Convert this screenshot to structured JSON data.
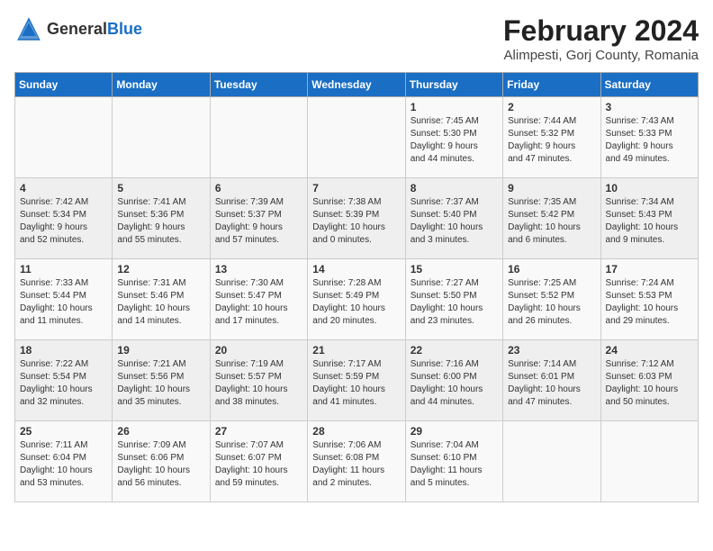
{
  "header": {
    "logo_general": "General",
    "logo_blue": "Blue",
    "month_year": "February 2024",
    "location": "Alimpesti, Gorj County, Romania"
  },
  "days_of_week": [
    "Sunday",
    "Monday",
    "Tuesday",
    "Wednesday",
    "Thursday",
    "Friday",
    "Saturday"
  ],
  "weeks": [
    [
      {
        "day": "",
        "info": ""
      },
      {
        "day": "",
        "info": ""
      },
      {
        "day": "",
        "info": ""
      },
      {
        "day": "",
        "info": ""
      },
      {
        "day": "1",
        "info": "Sunrise: 7:45 AM\nSunset: 5:30 PM\nDaylight: 9 hours\nand 44 minutes."
      },
      {
        "day": "2",
        "info": "Sunrise: 7:44 AM\nSunset: 5:32 PM\nDaylight: 9 hours\nand 47 minutes."
      },
      {
        "day": "3",
        "info": "Sunrise: 7:43 AM\nSunset: 5:33 PM\nDaylight: 9 hours\nand 49 minutes."
      }
    ],
    [
      {
        "day": "4",
        "info": "Sunrise: 7:42 AM\nSunset: 5:34 PM\nDaylight: 9 hours\nand 52 minutes."
      },
      {
        "day": "5",
        "info": "Sunrise: 7:41 AM\nSunset: 5:36 PM\nDaylight: 9 hours\nand 55 minutes."
      },
      {
        "day": "6",
        "info": "Sunrise: 7:39 AM\nSunset: 5:37 PM\nDaylight: 9 hours\nand 57 minutes."
      },
      {
        "day": "7",
        "info": "Sunrise: 7:38 AM\nSunset: 5:39 PM\nDaylight: 10 hours\nand 0 minutes."
      },
      {
        "day": "8",
        "info": "Sunrise: 7:37 AM\nSunset: 5:40 PM\nDaylight: 10 hours\nand 3 minutes."
      },
      {
        "day": "9",
        "info": "Sunrise: 7:35 AM\nSunset: 5:42 PM\nDaylight: 10 hours\nand 6 minutes."
      },
      {
        "day": "10",
        "info": "Sunrise: 7:34 AM\nSunset: 5:43 PM\nDaylight: 10 hours\nand 9 minutes."
      }
    ],
    [
      {
        "day": "11",
        "info": "Sunrise: 7:33 AM\nSunset: 5:44 PM\nDaylight: 10 hours\nand 11 minutes."
      },
      {
        "day": "12",
        "info": "Sunrise: 7:31 AM\nSunset: 5:46 PM\nDaylight: 10 hours\nand 14 minutes."
      },
      {
        "day": "13",
        "info": "Sunrise: 7:30 AM\nSunset: 5:47 PM\nDaylight: 10 hours\nand 17 minutes."
      },
      {
        "day": "14",
        "info": "Sunrise: 7:28 AM\nSunset: 5:49 PM\nDaylight: 10 hours\nand 20 minutes."
      },
      {
        "day": "15",
        "info": "Sunrise: 7:27 AM\nSunset: 5:50 PM\nDaylight: 10 hours\nand 23 minutes."
      },
      {
        "day": "16",
        "info": "Sunrise: 7:25 AM\nSunset: 5:52 PM\nDaylight: 10 hours\nand 26 minutes."
      },
      {
        "day": "17",
        "info": "Sunrise: 7:24 AM\nSunset: 5:53 PM\nDaylight: 10 hours\nand 29 minutes."
      }
    ],
    [
      {
        "day": "18",
        "info": "Sunrise: 7:22 AM\nSunset: 5:54 PM\nDaylight: 10 hours\nand 32 minutes."
      },
      {
        "day": "19",
        "info": "Sunrise: 7:21 AM\nSunset: 5:56 PM\nDaylight: 10 hours\nand 35 minutes."
      },
      {
        "day": "20",
        "info": "Sunrise: 7:19 AM\nSunset: 5:57 PM\nDaylight: 10 hours\nand 38 minutes."
      },
      {
        "day": "21",
        "info": "Sunrise: 7:17 AM\nSunset: 5:59 PM\nDaylight: 10 hours\nand 41 minutes."
      },
      {
        "day": "22",
        "info": "Sunrise: 7:16 AM\nSunset: 6:00 PM\nDaylight: 10 hours\nand 44 minutes."
      },
      {
        "day": "23",
        "info": "Sunrise: 7:14 AM\nSunset: 6:01 PM\nDaylight: 10 hours\nand 47 minutes."
      },
      {
        "day": "24",
        "info": "Sunrise: 7:12 AM\nSunset: 6:03 PM\nDaylight: 10 hours\nand 50 minutes."
      }
    ],
    [
      {
        "day": "25",
        "info": "Sunrise: 7:11 AM\nSunset: 6:04 PM\nDaylight: 10 hours\nand 53 minutes."
      },
      {
        "day": "26",
        "info": "Sunrise: 7:09 AM\nSunset: 6:06 PM\nDaylight: 10 hours\nand 56 minutes."
      },
      {
        "day": "27",
        "info": "Sunrise: 7:07 AM\nSunset: 6:07 PM\nDaylight: 10 hours\nand 59 minutes."
      },
      {
        "day": "28",
        "info": "Sunrise: 7:06 AM\nSunset: 6:08 PM\nDaylight: 11 hours\nand 2 minutes."
      },
      {
        "day": "29",
        "info": "Sunrise: 7:04 AM\nSunset: 6:10 PM\nDaylight: 11 hours\nand 5 minutes."
      },
      {
        "day": "",
        "info": ""
      },
      {
        "day": "",
        "info": ""
      }
    ]
  ]
}
